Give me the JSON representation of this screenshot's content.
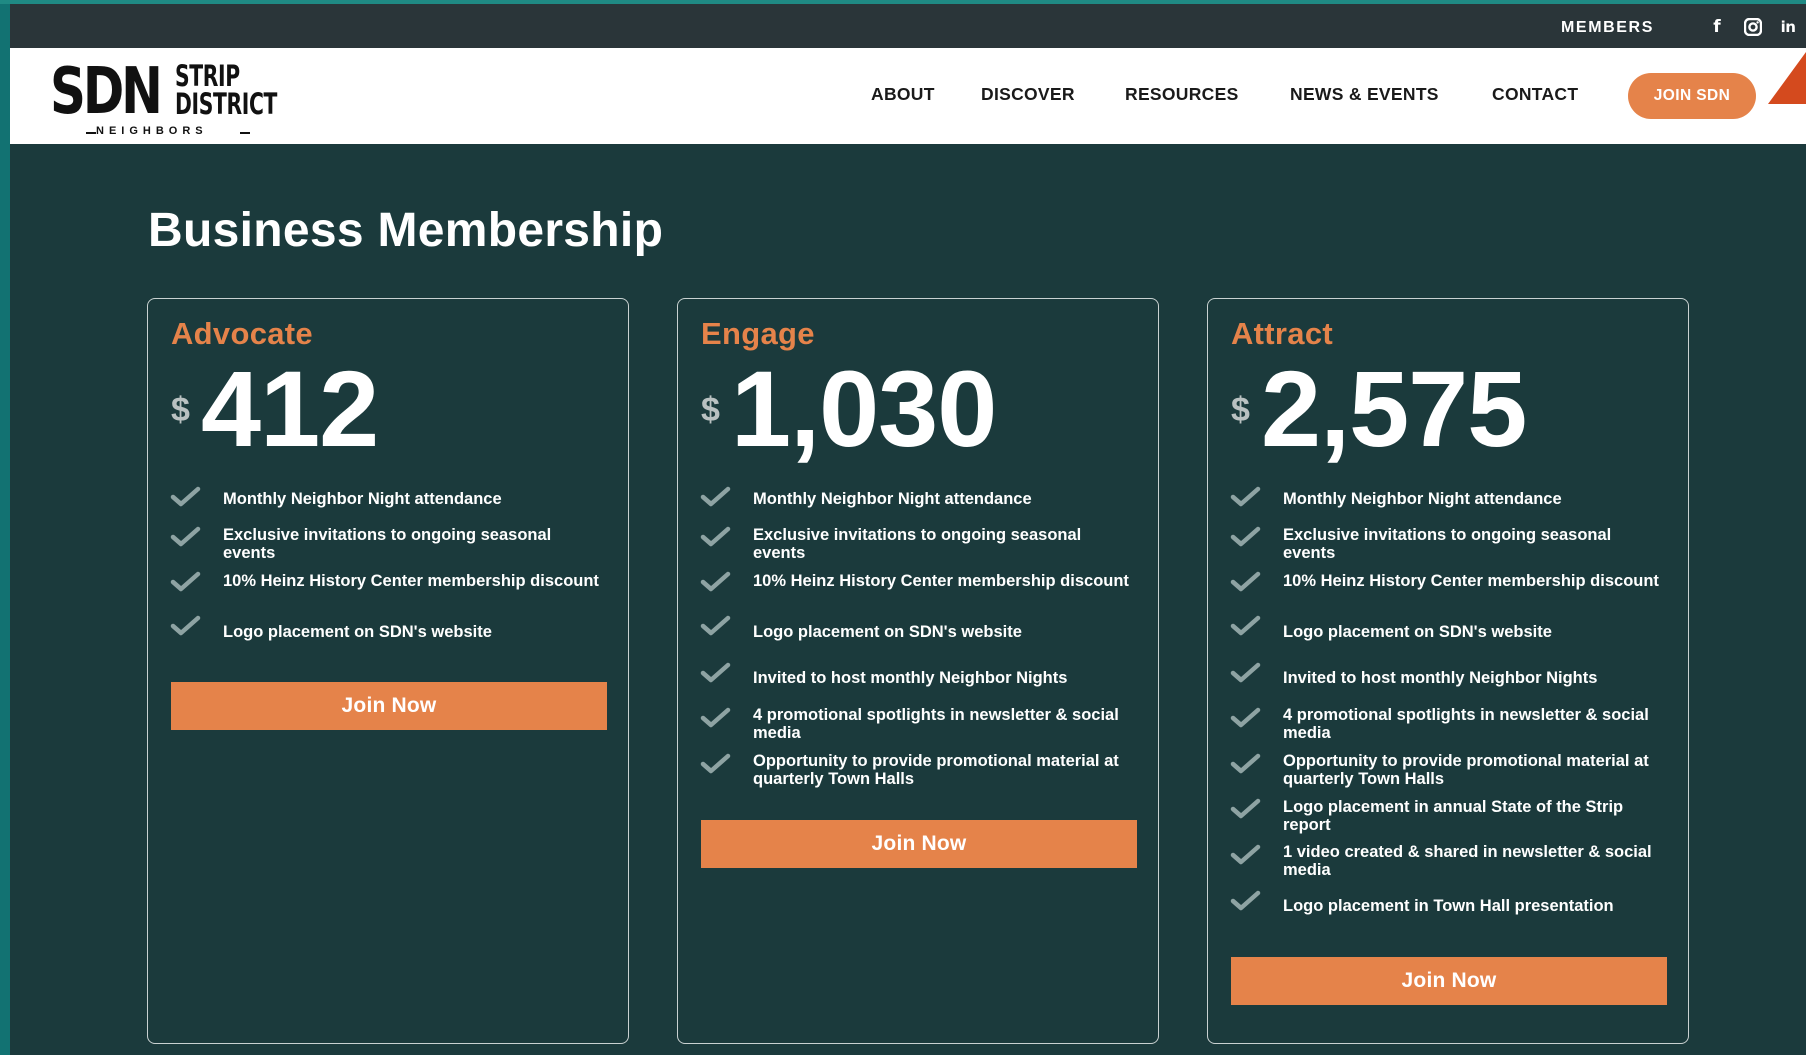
{
  "top_bar": {
    "members_label": "MEMBERS",
    "social": [
      {
        "icon": "facebook-icon",
        "glyph": "f"
      },
      {
        "icon": "instagram-icon"
      },
      {
        "icon": "linkedin-icon",
        "glyph": "in"
      }
    ]
  },
  "logo": {
    "mark": "SDN",
    "line1": "STRIP",
    "line2": "DISTRICT",
    "tagline": "NEIGHBORS"
  },
  "nav": {
    "items": [
      "ABOUT",
      "DISCOVER",
      "RESOURCES",
      "NEWS & EVENTS",
      "CONTACT"
    ],
    "cta": "JOIN SDN"
  },
  "page": {
    "title": "Business Membership"
  },
  "plans": [
    {
      "name": "Advocate",
      "currency": "$",
      "price": "412",
      "features": [
        "Monthly Neighbor Night attendance",
        "Exclusive invitations to ongoing seasonal events",
        "10% Heinz History Center membership discount",
        "Logo placement on SDN's website"
      ],
      "cta": "Join Now"
    },
    {
      "name": "Engage",
      "currency": "$",
      "price": "1,030",
      "features": [
        "Monthly Neighbor Night attendance",
        "Exclusive invitations to ongoing seasonal events",
        "10% Heinz History Center membership discount",
        "Logo placement on SDN's website",
        "Invited to host monthly Neighbor Nights",
        "4 promotional spotlights in newsletter & social media",
        "Opportunity to provide promotional material at quarterly Town Halls"
      ],
      "cta": "Join Now"
    },
    {
      "name": "Attract",
      "currency": "$",
      "price": "2,575",
      "features": [
        "Monthly Neighbor Night attendance",
        "Exclusive invitations to ongoing seasonal events",
        "10% Heinz History Center membership discount",
        "Logo placement on SDN's website",
        "Invited to host monthly Neighbor Nights",
        "4 promotional spotlights in newsletter & social media",
        "Opportunity to provide promotional material at quarterly Town Halls",
        "Logo placement in annual State of the Strip report",
        "1 video created & shared in newsletter & social media",
        "Logo placement in Town Hall presentation"
      ],
      "cta": "Join Now"
    }
  ],
  "colors": {
    "background": "#1b3a3c",
    "accent": "#e5834a",
    "check": "#8ea3a3"
  }
}
